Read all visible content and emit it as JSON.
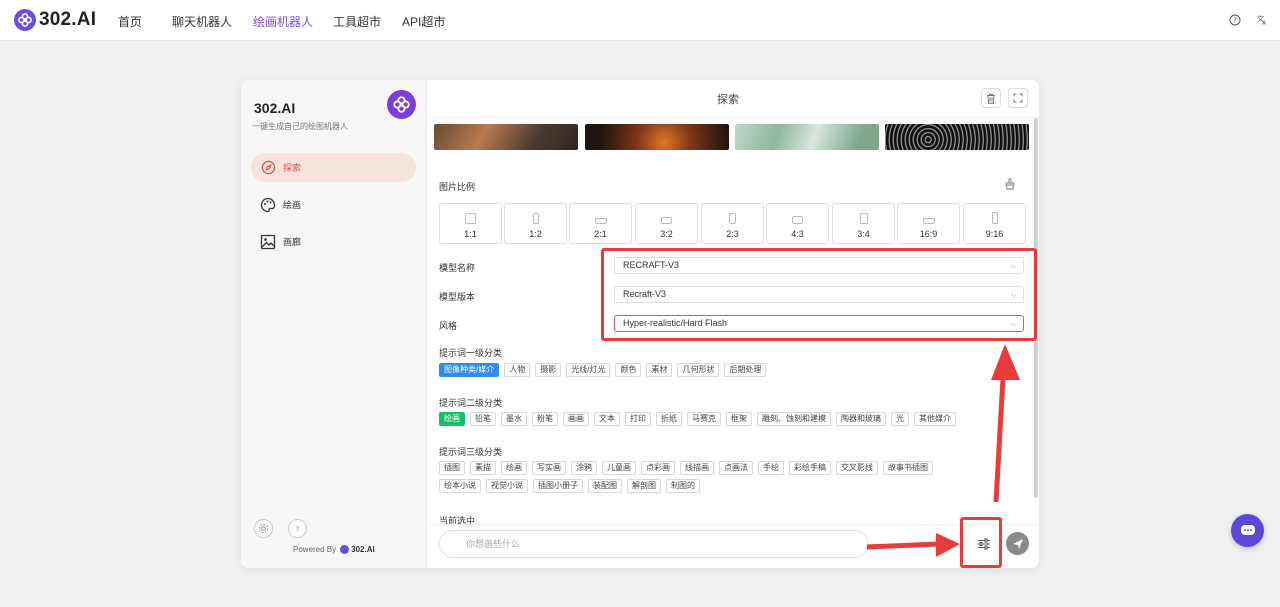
{
  "nav": {
    "brand": "302.AI",
    "items": [
      "首页",
      "聊天机器人",
      "绘画机器人",
      "工具超市",
      "API超市"
    ],
    "active_index": 2
  },
  "sidebar": {
    "title": "302.AI",
    "subtitle": "一键生成自己的绘图机器人",
    "items": [
      {
        "label": "探索",
        "icon": "compass-icon",
        "active": true
      },
      {
        "label": "绘画",
        "icon": "palette-icon",
        "active": false
      },
      {
        "label": "画廊",
        "icon": "image-icon",
        "active": false
      }
    ],
    "powered_prefix": "Powered By",
    "powered_brand": "302.AI"
  },
  "main": {
    "title": "探索",
    "ratio_label": "图片比例",
    "ratios": [
      "1:1",
      "1:2",
      "2:1",
      "3:2",
      "2:3",
      "4:3",
      "3:4",
      "16:9",
      "9:16"
    ],
    "model_name_label": "模型名称",
    "model_name_value": "RECRAFT-V3",
    "model_version_label": "模型版本",
    "model_version_value": "Recraft-V3",
    "style_label": "风格",
    "style_value": "Hyper-realistic/Hard Flash",
    "cat1_label": "提示词一级分类",
    "cat1": [
      "图像种类/媒介",
      "人物",
      "摄影",
      "光线/灯光",
      "颜色",
      "素材",
      "几何形状",
      "后期处理"
    ],
    "cat2_label": "提示词二级分类",
    "cat2": [
      "绘画",
      "铅笔",
      "墨水",
      "粉笔",
      "画画",
      "文本",
      "打印",
      "折纸",
      "马赛克",
      "框架",
      "雕刻、蚀刻和建模",
      "陶器和玻璃",
      "光",
      "其他媒介"
    ],
    "cat3_label": "提示词三级分类",
    "cat3": [
      "插图",
      "素描",
      "绘画",
      "写实画",
      "涂鸦",
      "儿童画",
      "点彩画",
      "线描画",
      "点画法",
      "手绘",
      "彩绘手稿",
      "交叉影线",
      "故事书插图",
      "绘本小说",
      "视觉小说",
      "插图小册子",
      "装配图",
      "解剖图",
      "制图的"
    ],
    "current_label": "当前选中",
    "input_placeholder": "你想画些什么"
  },
  "colors": {
    "accent": "#7b4fd6",
    "highlight_red": "#ea3b3b",
    "chip_blue": "#2d8cf0",
    "chip_green": "#19be6b"
  }
}
